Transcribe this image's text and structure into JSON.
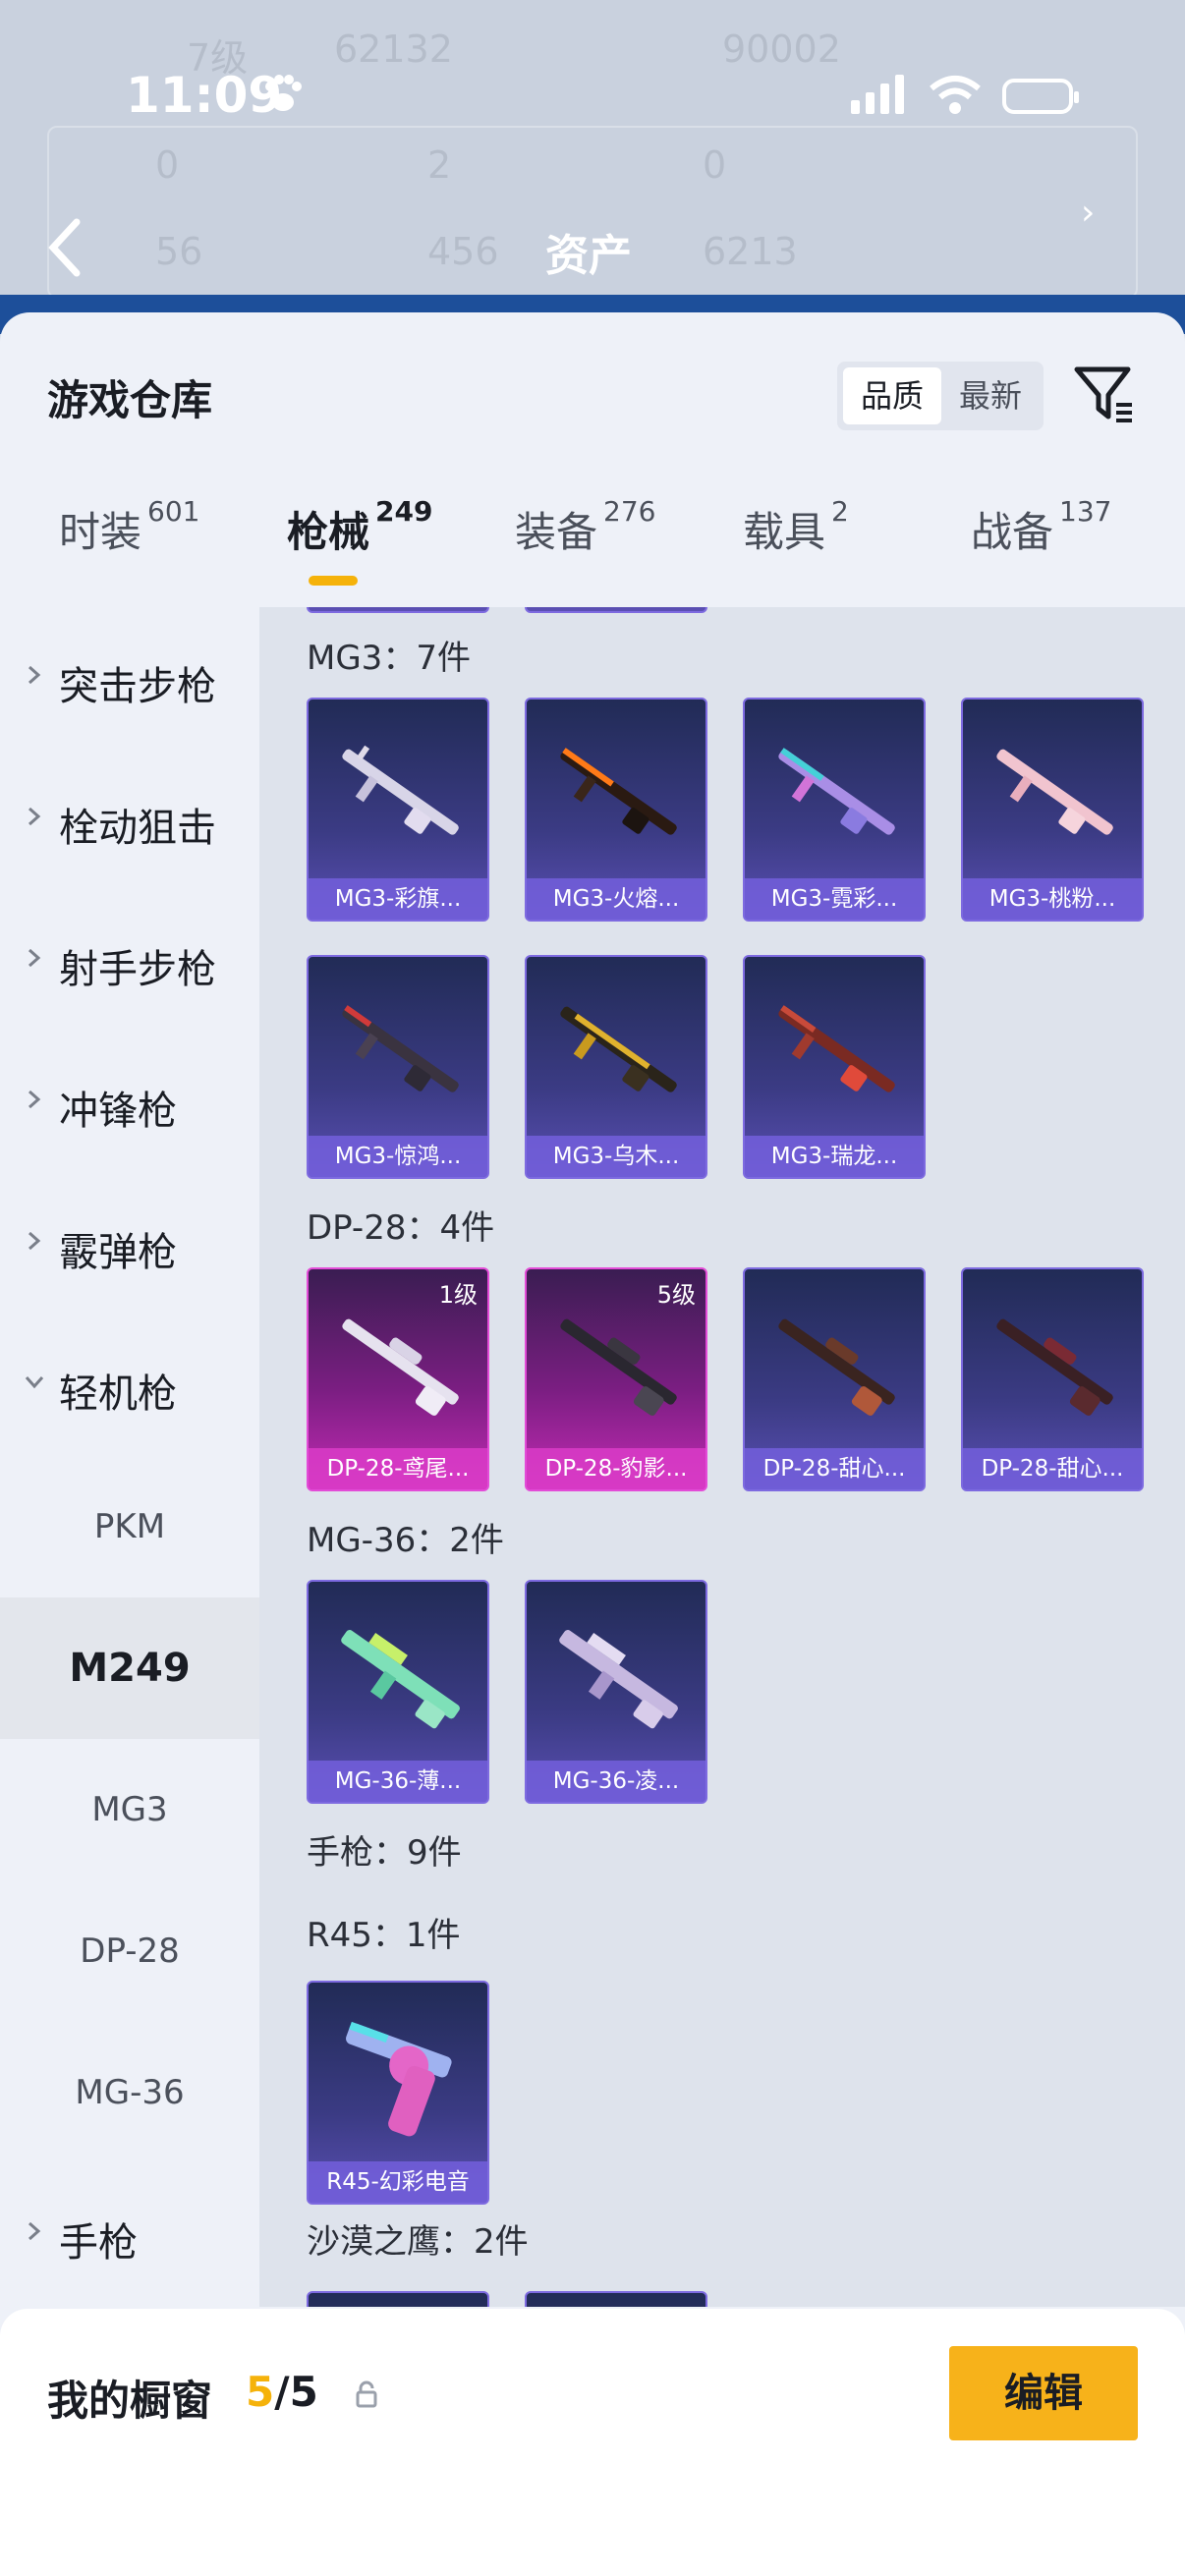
{
  "background": {
    "statusbar": {
      "time": "11:09"
    },
    "header_title": "资产",
    "blurred_text": [
      "7级",
      "62132",
      "90002",
      "0",
      "2",
      "0",
      "56",
      "456",
      "6213"
    ]
  },
  "sheet": {
    "title": "游戏仓库",
    "sort": {
      "options": [
        "品质",
        "最新"
      ],
      "active": "品质"
    },
    "tabs": [
      {
        "label": "时装",
        "count": "601"
      },
      {
        "label": "枪械",
        "count": "249"
      },
      {
        "label": "装备",
        "count": "276"
      },
      {
        "label": "载具",
        "count": "2"
      },
      {
        "label": "战备",
        "count": "137"
      }
    ],
    "sidebar": {
      "categories": [
        "突击步枪",
        "栓动狙击",
        "射手步枪",
        "冲锋枪",
        "霰弹枪",
        "轻机枪",
        "手枪"
      ],
      "subitems": [
        "PKM",
        "M249",
        "MG3",
        "DP-28",
        "MG-36"
      ],
      "selected": "M249"
    },
    "groups": [
      {
        "label": "MG3：7件",
        "items": [
          "MG3-彩旗...",
          "MG3-火熔...",
          "MG3-霓彩...",
          "MG3-桃粉...",
          "MG3-惊鸿...",
          "MG3-乌木...",
          "MG3-瑞龙..."
        ]
      },
      {
        "label": "DP-28：4件",
        "items": [
          "DP-28-鸢尾...",
          "DP-28-豹影...",
          "DP-28-甜心...",
          "DP-28-甜心..."
        ],
        "levels": [
          "1级",
          "5级"
        ]
      },
      {
        "label": "MG-36：2件",
        "items": [
          "MG-36-薄...",
          "MG-36-凌..."
        ]
      },
      {
        "label": "手枪：9件",
        "items": []
      },
      {
        "label": "R45：1件",
        "items": [
          "R45-幻彩电音"
        ]
      },
      {
        "label": "沙漠之鹰：2件",
        "items": []
      }
    ]
  },
  "bottom": {
    "showcase_label": "我的橱窗",
    "count_used": "5",
    "count_total": "/5",
    "edit_label": "编辑"
  },
  "colors": {
    "accent": "#f5b20a",
    "purple_card": "#3b3b84",
    "pink_card": "#c22bb3"
  }
}
